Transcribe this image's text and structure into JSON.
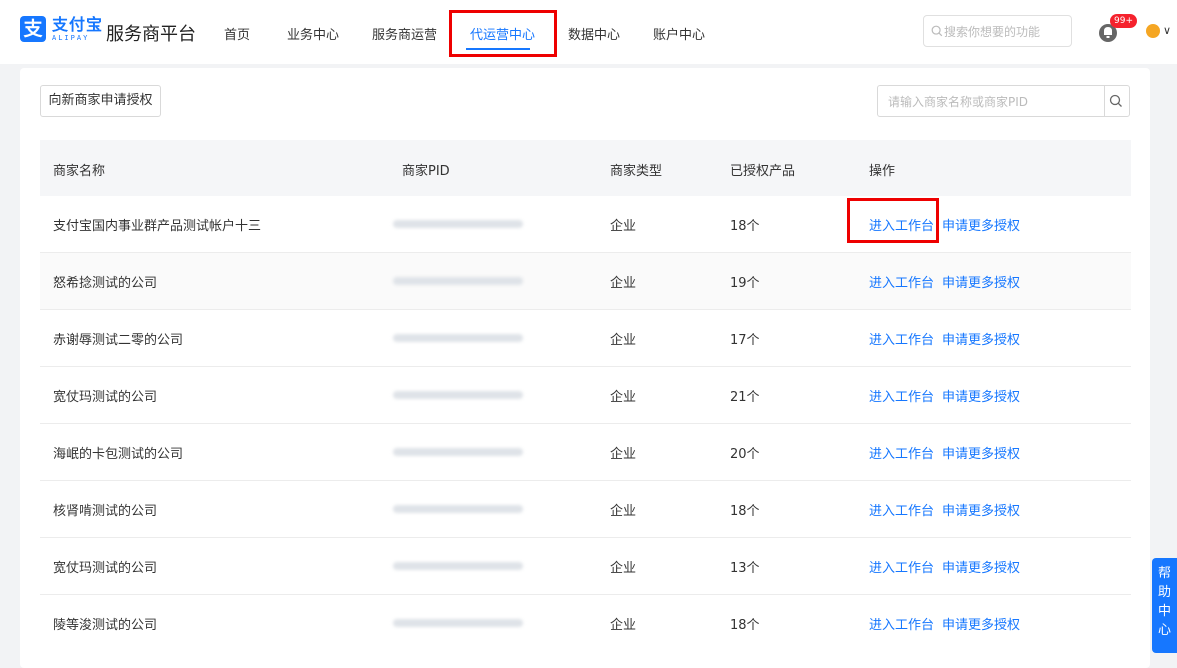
{
  "header": {
    "logo_cn": "支付宝",
    "logo_en": "ALIPAY",
    "platform_title": "服务商平台",
    "nav": [
      "首页",
      "业务中心",
      "服务商运营",
      "代运营中心",
      "数据中心",
      "账户中心"
    ],
    "active_nav": "代运营中心",
    "search_placeholder": "搜索你想要的功能",
    "notification_badge": "99+"
  },
  "toolbar": {
    "apply_button": "向新商家申请授权",
    "search_placeholder": "请输入商家名称或商家PID"
  },
  "table": {
    "columns": [
      "商家名称",
      "商家PID",
      "商家类型",
      "已授权产品",
      "操作"
    ],
    "rows": [
      {
        "name": "支付宝国内事业群产品测试帐户十三",
        "type": "企业",
        "products": "18个",
        "op1": "进入工作台",
        "op2": "申请更多授权"
      },
      {
        "name": "怒希捻测试的公司",
        "type": "企业",
        "products": "19个",
        "op1": "进入工作台",
        "op2": "申请更多授权"
      },
      {
        "name": "赤谢辱测试二零的公司",
        "type": "企业",
        "products": "17个",
        "op1": "进入工作台",
        "op2": "申请更多授权"
      },
      {
        "name": "宽仗玛测试的公司",
        "type": "企业",
        "products": "21个",
        "op1": "进入工作台",
        "op2": "申请更多授权"
      },
      {
        "name": "海岷的卡包测试的公司",
        "type": "企业",
        "products": "20个",
        "op1": "进入工作台",
        "op2": "申请更多授权"
      },
      {
        "name": "核肾啃测试的公司",
        "type": "企业",
        "products": "18个",
        "op1": "进入工作台",
        "op2": "申请更多授权"
      },
      {
        "name": "宽仗玛测试的公司",
        "type": "企业",
        "products": "13个",
        "op1": "进入工作台",
        "op2": "申请更多授权"
      },
      {
        "name": "陵等浚测试的公司",
        "type": "企业",
        "products": "18个",
        "op1": "进入工作台",
        "op2": "申请更多授权"
      }
    ]
  },
  "help_widget": [
    "帮",
    "助",
    "中",
    "心"
  ],
  "colors": {
    "accent": "#1677ff",
    "highlight": "#ee0000"
  }
}
